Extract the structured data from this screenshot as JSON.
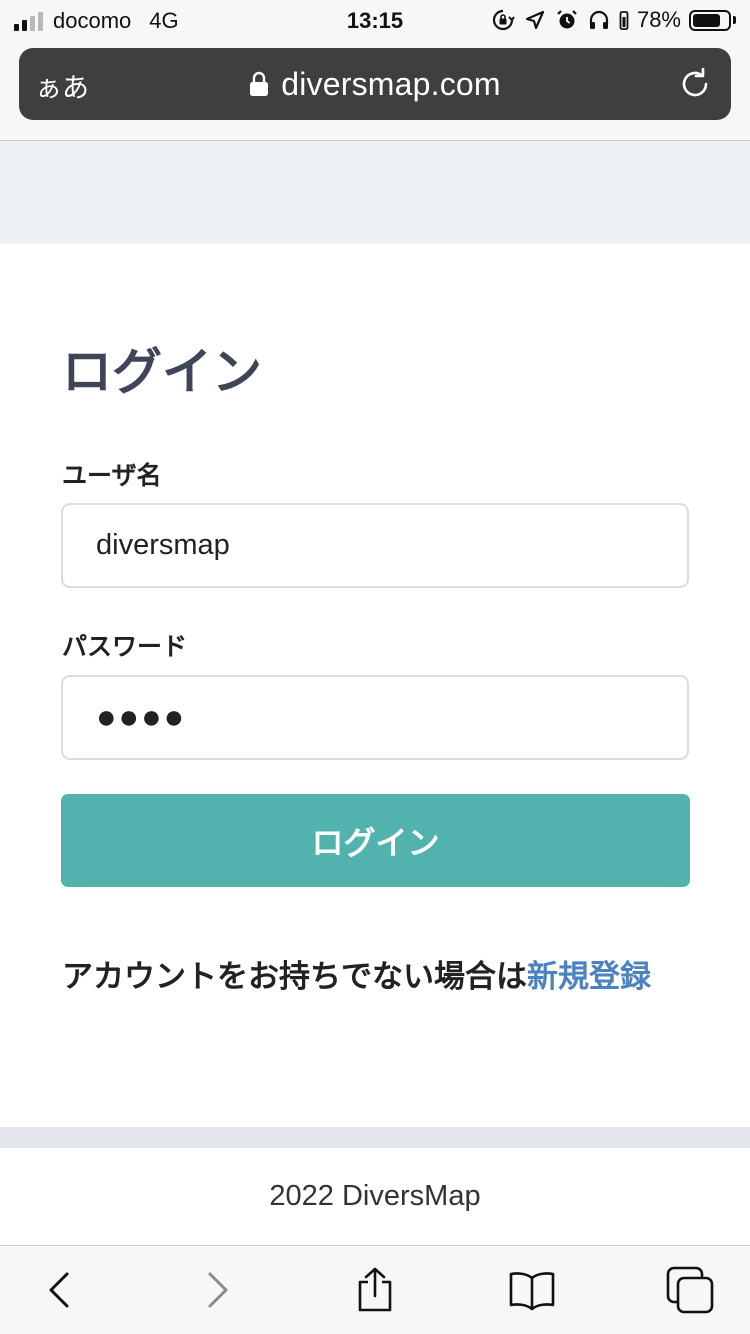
{
  "status_bar": {
    "carrier": "docomo",
    "network": "4G",
    "time": "13:15",
    "battery_percent": "78%",
    "battery_level": 0.78
  },
  "browser": {
    "text_size_button": "ぁあ",
    "url": "diversmap.com"
  },
  "login": {
    "title": "ログイン",
    "username_label": "ユーザ名",
    "username_value": "diversmap",
    "password_label": "パスワード",
    "password_value": "●●●●",
    "submit_label": "ログイン",
    "no_account_text": "アカウントをお持ちでない場合は",
    "signup_link": "新規登録"
  },
  "footer": {
    "copyright": "2022 DiversMap"
  },
  "colors": {
    "accent": "#52b3ae",
    "link": "#4b83c0",
    "title": "#3d4557"
  }
}
